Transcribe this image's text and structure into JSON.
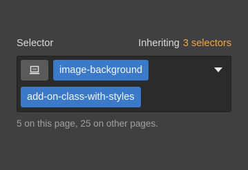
{
  "selector_panel": {
    "label": "Selector",
    "inheriting_text": "Inheriting",
    "inheriting_link": "3 selectors",
    "device_icon": "desktop-icon",
    "classes": [
      "image-background",
      "add-on-class-with-styles"
    ],
    "usage_note": "5 on this page, 25 on other pages."
  },
  "colors": {
    "background": "#404040",
    "field_background": "#2b2b2b",
    "chip": "#3b79c9",
    "accent": "#f0a64a",
    "muted_text": "#a0a0a0"
  }
}
